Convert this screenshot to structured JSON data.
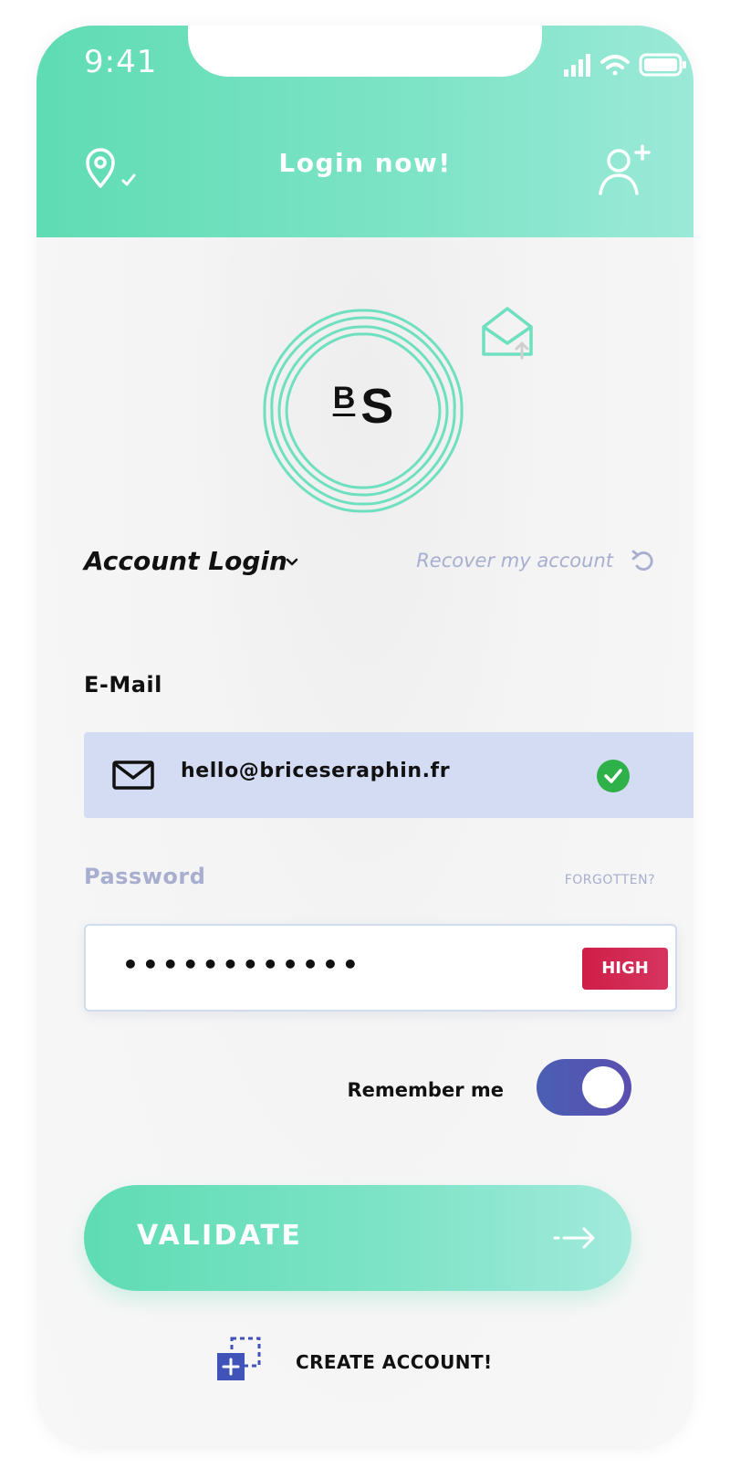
{
  "status_bar": {
    "time": "9:41",
    "icons": [
      "signal-icon",
      "wifi-icon",
      "battery-icon"
    ]
  },
  "header": {
    "title": "Login now!",
    "left_icon": "location-check-icon",
    "right_icon": "add-user-icon"
  },
  "logo": {
    "monogram_small": "B",
    "monogram_large": "S",
    "badge_icon": "mail-upload-icon"
  },
  "section": {
    "title": "Account Login",
    "recover_label": "Recover my account",
    "recover_icon": "undo-icon"
  },
  "email": {
    "label": "E-Mail",
    "value": "hello@briceseraphin.fr",
    "icon": "mail-icon",
    "status_icon": "check-icon"
  },
  "password": {
    "label": "Password",
    "forgot_label": "FORGOTTEN?",
    "masked_value": "••••••••••••",
    "strength": "HIGH"
  },
  "remember": {
    "label": "Remember me",
    "enabled": true
  },
  "validate": {
    "label": "VALIDATE",
    "icon": "arrow-right-icon"
  },
  "create_account": {
    "label": "CREATE ACCOUNT!",
    "icon": "create-account-icon"
  },
  "colors": {
    "accent": "#5fdcb3",
    "accent_light": "#9be9d8",
    "field_bg": "#d4dcf3",
    "muted_text": "#a8aecf",
    "danger": "#cf1e47",
    "toggle": "#4a5fb3",
    "success": "#2fb14a"
  }
}
